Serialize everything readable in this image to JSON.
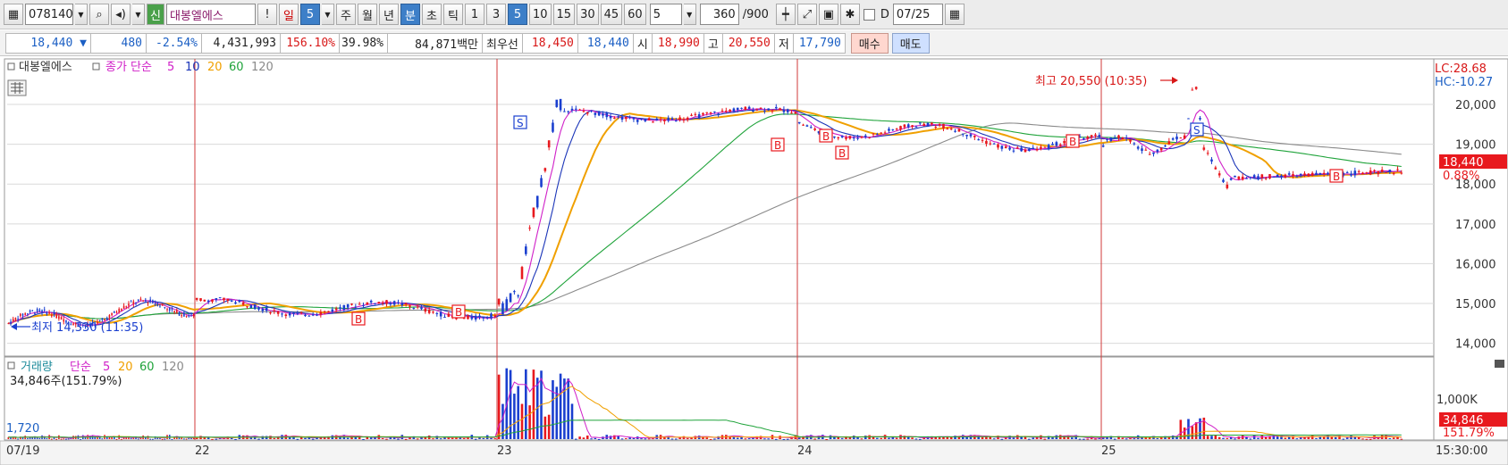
{
  "toolbar": {
    "code": "078140",
    "stock_badge": "신",
    "stock_name": "대봉엘에스",
    "periods": [
      "일",
      "5",
      "주",
      "월",
      "년",
      "분",
      "초",
      "틱"
    ],
    "intervals": [
      "1",
      "3",
      "5",
      "10",
      "15",
      "30",
      "45",
      "60"
    ],
    "selected_interval": "5",
    "interval_input": "5",
    "count_value": "360",
    "count_max": "/900",
    "date_check_label": "D",
    "date_value": "07/25"
  },
  "quote": {
    "price": "18,440 ▼",
    "change": "480",
    "change_pct": "-2.54%",
    "volume": "4,431,993",
    "volume_ratio": "156.10%",
    "turnover_pct": "39.98%",
    "amount": "84,871백만",
    "best_label": "최우선",
    "ask": "18,450",
    "bid": "18,440",
    "open_label": "시",
    "open": "18,990",
    "high_label": "고",
    "high": "20,550",
    "low_label": "저",
    "low": "17,790",
    "buy_label": "매수",
    "sell_label": "매도"
  },
  "price_panel": {
    "stock_label": "대봉엘에스",
    "ma_label": "종가 단순",
    "ma_periods": [
      "5",
      "10",
      "20",
      "60",
      "120"
    ],
    "lc": "LC:28.68",
    "hc": "HC:-10.27",
    "high_annotation": "최고 20,550 (10:35)",
    "low_annotation": "최저 14,330 (11:35)",
    "current_price_tag": "18,440",
    "current_pct_tag": "0.88%",
    "buy_signal": "B",
    "sell_signal": "S"
  },
  "volume_panel": {
    "label": "거래량",
    "ma_label": "단순",
    "ma_periods": [
      "5",
      "20",
      "60",
      "120"
    ],
    "summary": "34,846주(151.79%)",
    "left_value": "1,720",
    "volume_tag": "34,846",
    "volume_pct_tag": "151.79%"
  },
  "x_axis": {
    "labels": [
      "07/19",
      "22",
      "23",
      "24",
      "25"
    ],
    "time_label": "15:30:00"
  },
  "colors": {
    "up": "#e8191e",
    "down": "#1a3fcf",
    "ma5": "#d020c8",
    "ma10": "#1a34b8",
    "ma20": "#f0a000",
    "ma60": "#1fa33a",
    "ma120": "#8a8a8a",
    "day_line": "#d23a3a"
  },
  "chart_data": {
    "type": "candlestick",
    "interval": "5분",
    "y_axis": {
      "ticks": [
        14000,
        15000,
        16000,
        17000,
        18000,
        19000,
        20000
      ],
      "range": [
        13700,
        21100
      ]
    },
    "volume_axis": {
      "ticks": [
        "1,000K"
      ]
    },
    "days": [
      {
        "label": "07/19",
        "open": 14500,
        "high": 15300,
        "low": 14330,
        "close": 14950
      },
      {
        "label": "22",
        "open": 14950,
        "high": 15100,
        "low": 14400,
        "close": 14800
      },
      {
        "label": "23",
        "open": 14900,
        "high": 20100,
        "low": 14850,
        "close": 19750
      },
      {
        "label": "24",
        "open": 19500,
        "high": 19550,
        "low": 18600,
        "close": 18950
      },
      {
        "label": "25",
        "open": 18990,
        "high": 20550,
        "low": 17790,
        "close": 18440
      }
    ],
    "high": {
      "value": 20550,
      "time": "10:35"
    },
    "low": {
      "value": 14330,
      "time": "11:35"
    },
    "last_close": 18440,
    "last_volume": 34846
  }
}
